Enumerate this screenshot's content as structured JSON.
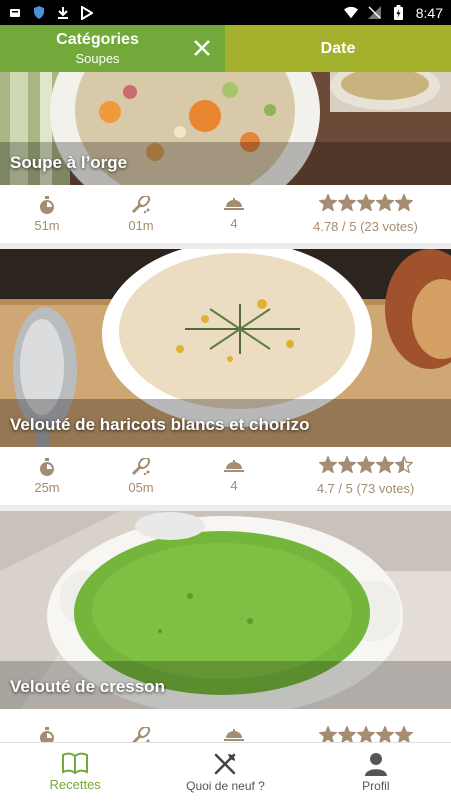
{
  "status_bar": {
    "time": "8:47",
    "icons": [
      "notification-icon",
      "shield-icon",
      "download-icon",
      "media-icon",
      "wifi-icon",
      "no-sim-icon",
      "battery-icon"
    ]
  },
  "filter_bar": {
    "category_title": "Catégories",
    "category_value": "Soupes",
    "date_label": "Date",
    "colors": {
      "category_bg": "#73a93a",
      "date_bg": "#a4b12d"
    }
  },
  "recipes": [
    {
      "title": "Soupe à l’orge",
      "prep_time": "51m",
      "cook_time": "01m",
      "servings": "4",
      "stars": 5,
      "rating": "4.78 / 5 (23 votes)"
    },
    {
      "title": "Velouté de haricots blancs et chorizo",
      "prep_time": "25m",
      "cook_time": "05m",
      "servings": "4",
      "stars": 4.5,
      "rating": "4.7 / 5 (73 votes)"
    },
    {
      "title": "Velouté de cresson",
      "stars": 5
    }
  ],
  "bottom_nav": [
    {
      "label": "Recettes",
      "icon": "book-icon",
      "active": true
    },
    {
      "label": "Quoi de neuf ?",
      "icon": "utensils-icon",
      "active": false
    },
    {
      "label": "Profil",
      "icon": "user-icon",
      "active": false
    }
  ],
  "colors": {
    "accent": "#73a93a",
    "meta_text": "#a48d72",
    "star": "#a48d72"
  }
}
